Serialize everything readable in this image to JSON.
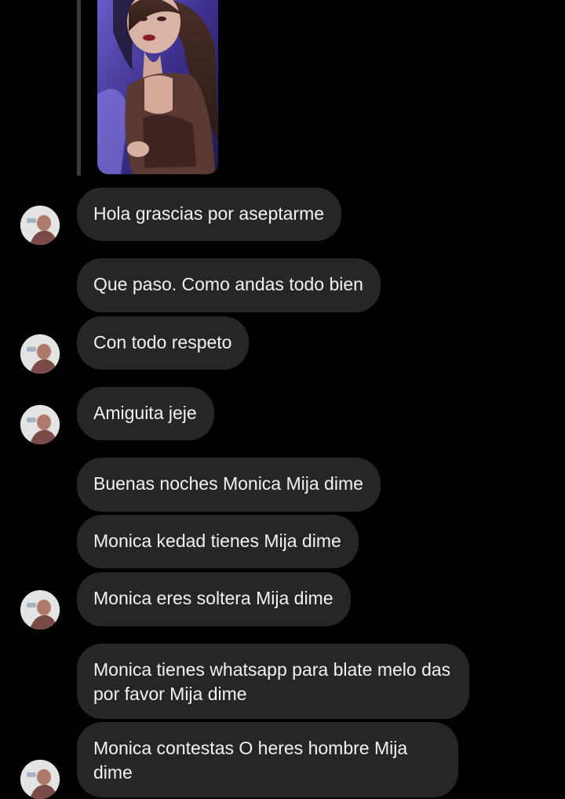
{
  "theme": {
    "background": "#000000",
    "bubble": "#262626",
    "text": "#f2f2f2"
  },
  "chat": {
    "shared_image": {
      "icon": "photo-thumbnail",
      "kind": "reply-preview"
    },
    "messages": [
      {
        "text": "Hola grascias por aseptarme"
      },
      {
        "text": "Que paso. Como andas todo bien"
      },
      {
        "text": "Con todo respeto"
      },
      {
        "text": "Amiguita jeje"
      },
      {
        "text": "Buenas noches Monica Mija dime"
      },
      {
        "text": "Monica kedad tienes Mija dime"
      },
      {
        "text": "Monica eres soltera Mija dime"
      },
      {
        "text": "Monica tienes whatsapp para blate melo das por favor Mija dime"
      },
      {
        "text": "Monica contestas O heres hombre Mija dime"
      }
    ]
  }
}
